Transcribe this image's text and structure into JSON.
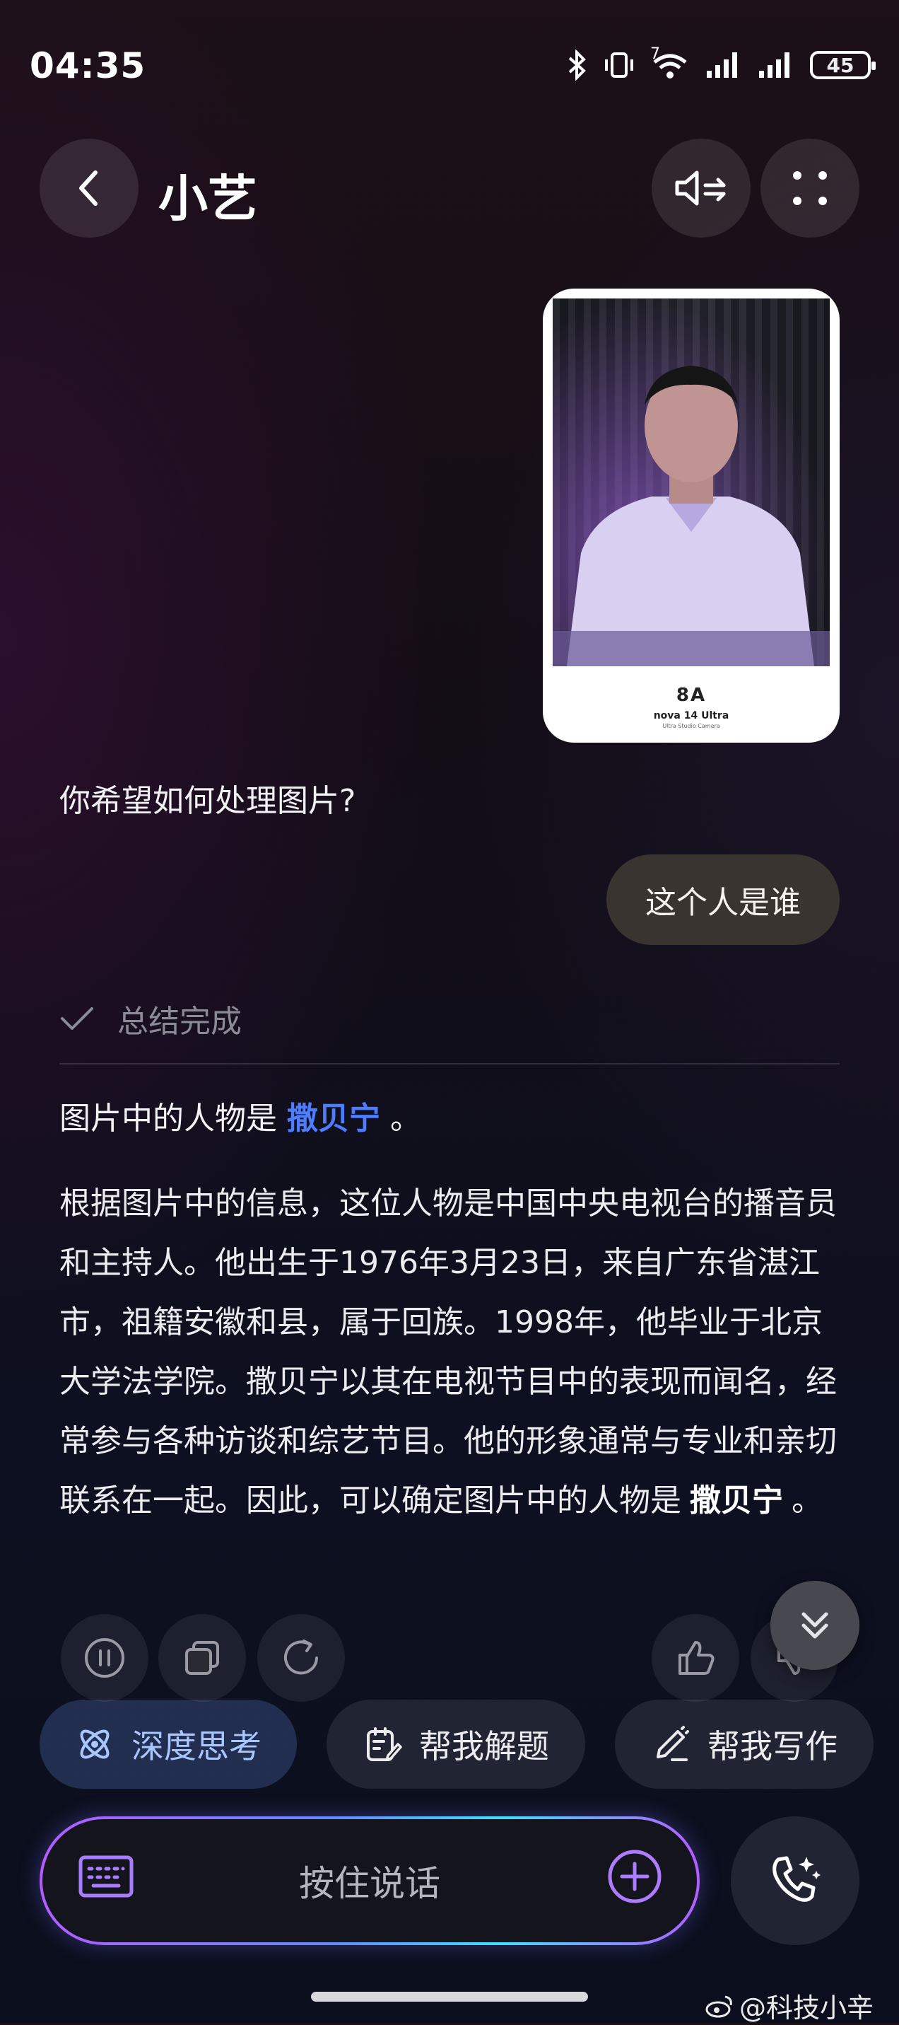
{
  "status": {
    "time": "04:35",
    "network_tag": "7",
    "battery": "45"
  },
  "header": {
    "title": "小艺",
    "back_icon": "chevron-left-icon",
    "sound_icon": "speaker-icon",
    "more_icon": "grid-dots-icon"
  },
  "image_card": {
    "brand": "nova 14 Ultra",
    "logo_text": "8A",
    "sub": "Ultra Studio Camera"
  },
  "chat": {
    "assistant_question": "你希望如何处理图片?",
    "user_message": "这个人是谁",
    "summary_label": "总结完成",
    "answer_prefix": "图片中的人物是",
    "answer_name": "撒贝宁",
    "answer_suffix": "。",
    "paragraph_main": "根据图片中的信息，这位人物是中国中央电视台的播音员和主持人。他出生于1976年3月23日，来自广东省湛江市，祖籍安徽和县，属于回族。1998年，他毕业于北京大学法学院。撒贝宁以其在电视节目中的表现而闻名，经常参与各种访谈和综艺节目。他的形象通常与专业和亲切联系在一起。因此，可以确定图片中的人物是",
    "paragraph_name": "撒贝宁",
    "paragraph_end": "。"
  },
  "chips": [
    {
      "label": "深度思考",
      "icon": "atom-icon"
    },
    {
      "label": "帮我解题",
      "icon": "clipboard-edit-icon"
    },
    {
      "label": "帮我写作",
      "icon": "pen-icon"
    }
  ],
  "input": {
    "placeholder": "按住说话",
    "keyboard_icon": "keyboard-icon",
    "plus_icon": "plus-icon",
    "call_icon": "phone-sparkle-icon"
  },
  "watermark": "@科技小辛"
}
